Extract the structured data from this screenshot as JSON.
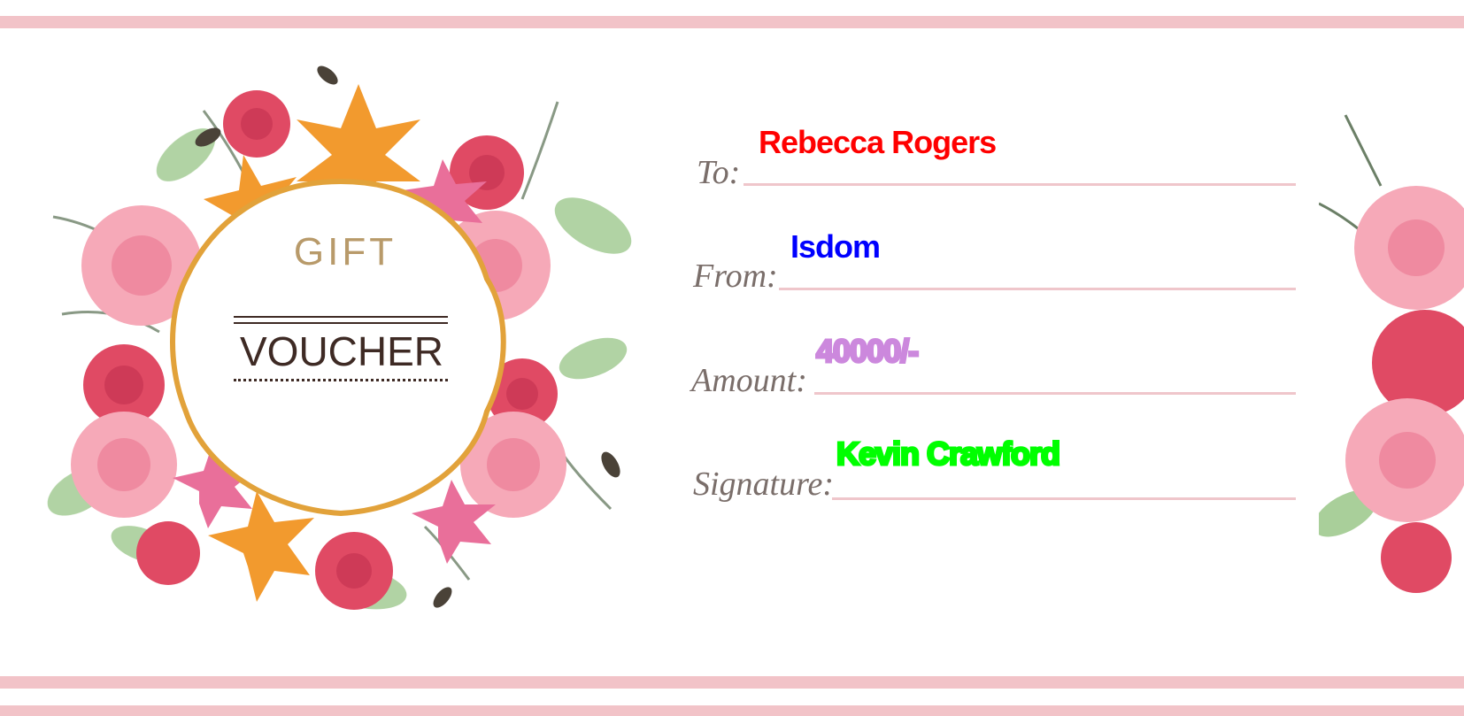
{
  "voucher": {
    "title_top": "GIFT",
    "title_main": "VOUCHER"
  },
  "fields": {
    "to": {
      "label": "To:",
      "value": "Rebecca Rogers"
    },
    "from": {
      "label": "From:",
      "value": "Isdom"
    },
    "amount": {
      "label": "Amount:",
      "value": "40000/-"
    },
    "signature": {
      "label": "Signature:",
      "value": "Kevin Crawford"
    }
  },
  "colors": {
    "stripe": "#f2c3c8",
    "line": "#efc6cb",
    "label": "#7a6e6a",
    "gift_text": "#b89a6a",
    "voucher_text": "#3e2a24",
    "frame_gold": "#e2a23a",
    "to_value": "#ff0000",
    "from_value": "#0000ff",
    "amount_value": "#cc88dd",
    "signature_value": "#00ff00"
  }
}
